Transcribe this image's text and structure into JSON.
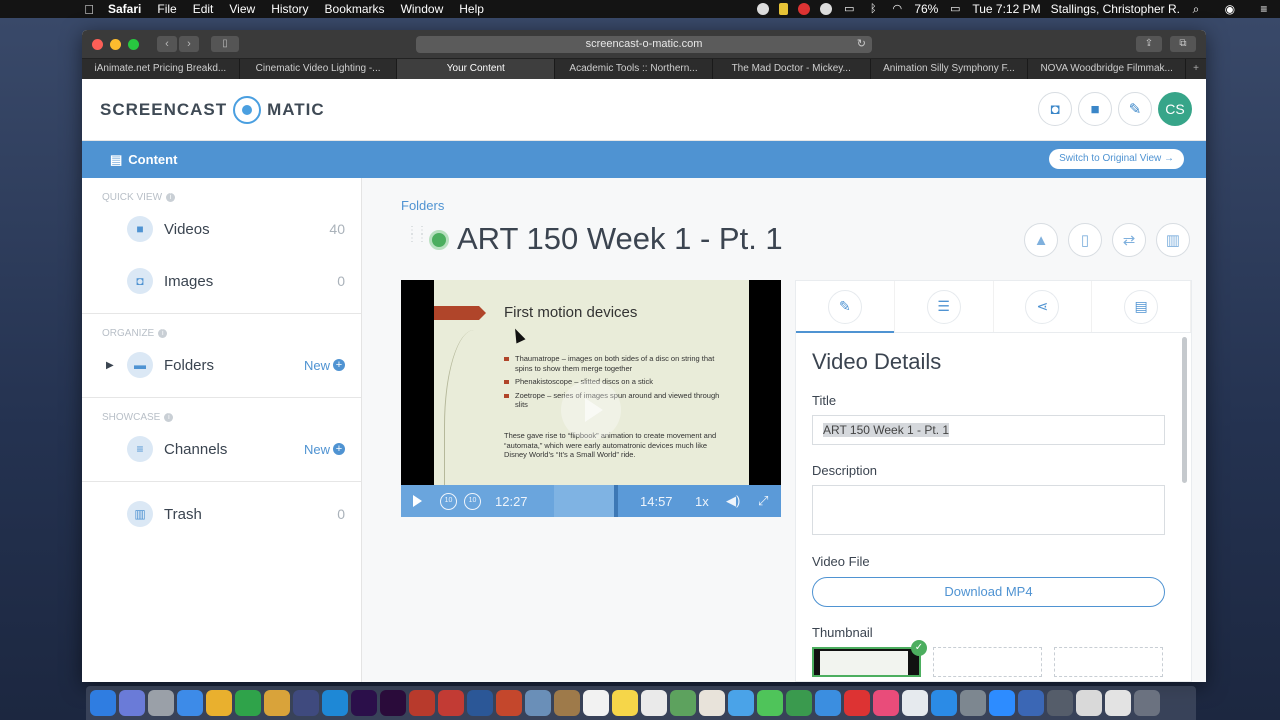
{
  "menubar": {
    "app": "Safari",
    "items": [
      "File",
      "Edit",
      "View",
      "History",
      "Bookmarks",
      "Window",
      "Help"
    ],
    "battery": "76%",
    "clock": "Tue 7:12 PM",
    "user": "Stallings, Christopher R."
  },
  "browser": {
    "url": "screencast-o-matic.com",
    "tabs": [
      "iAnimate.net Pricing Breakd...",
      "Cinematic Video Lighting -...",
      "Your Content",
      "Academic Tools :: Northern...",
      "The Mad Doctor - Mickey...",
      "Animation Silly Symphony F...",
      "NOVA Woodbridge Filmmak..."
    ]
  },
  "site": {
    "logo_left": "SCREENCAST",
    "logo_right": "MATIC",
    "avatar": "CS",
    "content_tab": "Content",
    "switch_view": "Switch to Original View →"
  },
  "sidebar": {
    "quick_view": "QUICK VIEW",
    "videos": "Videos",
    "videos_count": "40",
    "images": "Images",
    "images_count": "0",
    "organize": "ORGANIZE",
    "folders": "Folders",
    "new_label": "New",
    "showcase": "SHOWCASE",
    "channels": "Channels",
    "trash": "Trash",
    "trash_count": "0"
  },
  "main": {
    "breadcrumb": "Folders",
    "title": "ART 150 Week 1 - Pt. 1"
  },
  "video": {
    "slide_title": "First motion devices",
    "bullets": [
      "Thaumatrope – images on both sides of a disc on string that spins to show them merge together",
      "Phenakistoscope – slitted discs on a stick",
      "Zoetrope – series of images spun around and viewed through slits"
    ],
    "paragraph": "These gave rise to “flipbook” animation to create movement and “automata,” which were early automatronic devices much like Disney World’s “It’s a Small World” ride.",
    "current_time": "12:27",
    "duration": "14:57",
    "speed": "1x",
    "rewind": "10",
    "forward": "10"
  },
  "details": {
    "heading": "Video Details",
    "title_label": "Title",
    "title_value": "ART 150 Week 1 - Pt. 1",
    "description_label": "Description",
    "video_file_label": "Video File",
    "download": "Download MP4",
    "thumbnail_label": "Thumbnail"
  }
}
